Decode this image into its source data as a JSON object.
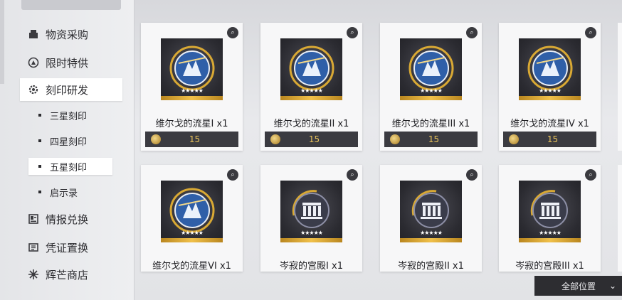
{
  "sidebar": {
    "items": [
      {
        "label": "物资采购",
        "icon": "supply-crate-icon"
      },
      {
        "label": "限时特供",
        "icon": "limited-offer-icon"
      },
      {
        "label": "刻印研发",
        "icon": "imprint-gear-icon",
        "active": true
      },
      {
        "label": "情报兑换",
        "icon": "intel-card-icon"
      },
      {
        "label": "凭证置换",
        "icon": "voucher-icon"
      },
      {
        "label": "辉芒商店",
        "icon": "radiance-shop-icon"
      }
    ],
    "sub_items": [
      {
        "label": "三星刻印"
      },
      {
        "label": "四星刻印"
      },
      {
        "label": "五星刻印",
        "active": true
      },
      {
        "label": "启示录"
      }
    ]
  },
  "grid": {
    "row1": [
      {
        "name": "维尔戈的流星I x1",
        "price": "15",
        "emblem": "meteor-emblem"
      },
      {
        "name": "维尔戈的流星II x1",
        "price": "15",
        "emblem": "meteor-emblem"
      },
      {
        "name": "维尔戈的流星III x1",
        "price": "15",
        "emblem": "meteor-emblem"
      },
      {
        "name": "维尔戈的流星IV x1",
        "price": "15",
        "emblem": "meteor-emblem"
      }
    ],
    "row2": [
      {
        "name": "维尔戈的流星VI x1",
        "emblem": "meteor-emblem"
      },
      {
        "name": "岑寂的宫殿I x1",
        "emblem": "palace-emblem"
      },
      {
        "name": "岑寂的宫殿II x1",
        "emblem": "palace-emblem"
      },
      {
        "name": "岑寂的宫殿III x1",
        "emblem": "palace-emblem"
      }
    ],
    "stars": "★★★★★"
  },
  "filter": {
    "label": "全部位置",
    "chevron": "chevron-down-icon"
  },
  "colors": {
    "accent_gold": "#e9c25a",
    "dark_panel": "#3b3b41"
  }
}
